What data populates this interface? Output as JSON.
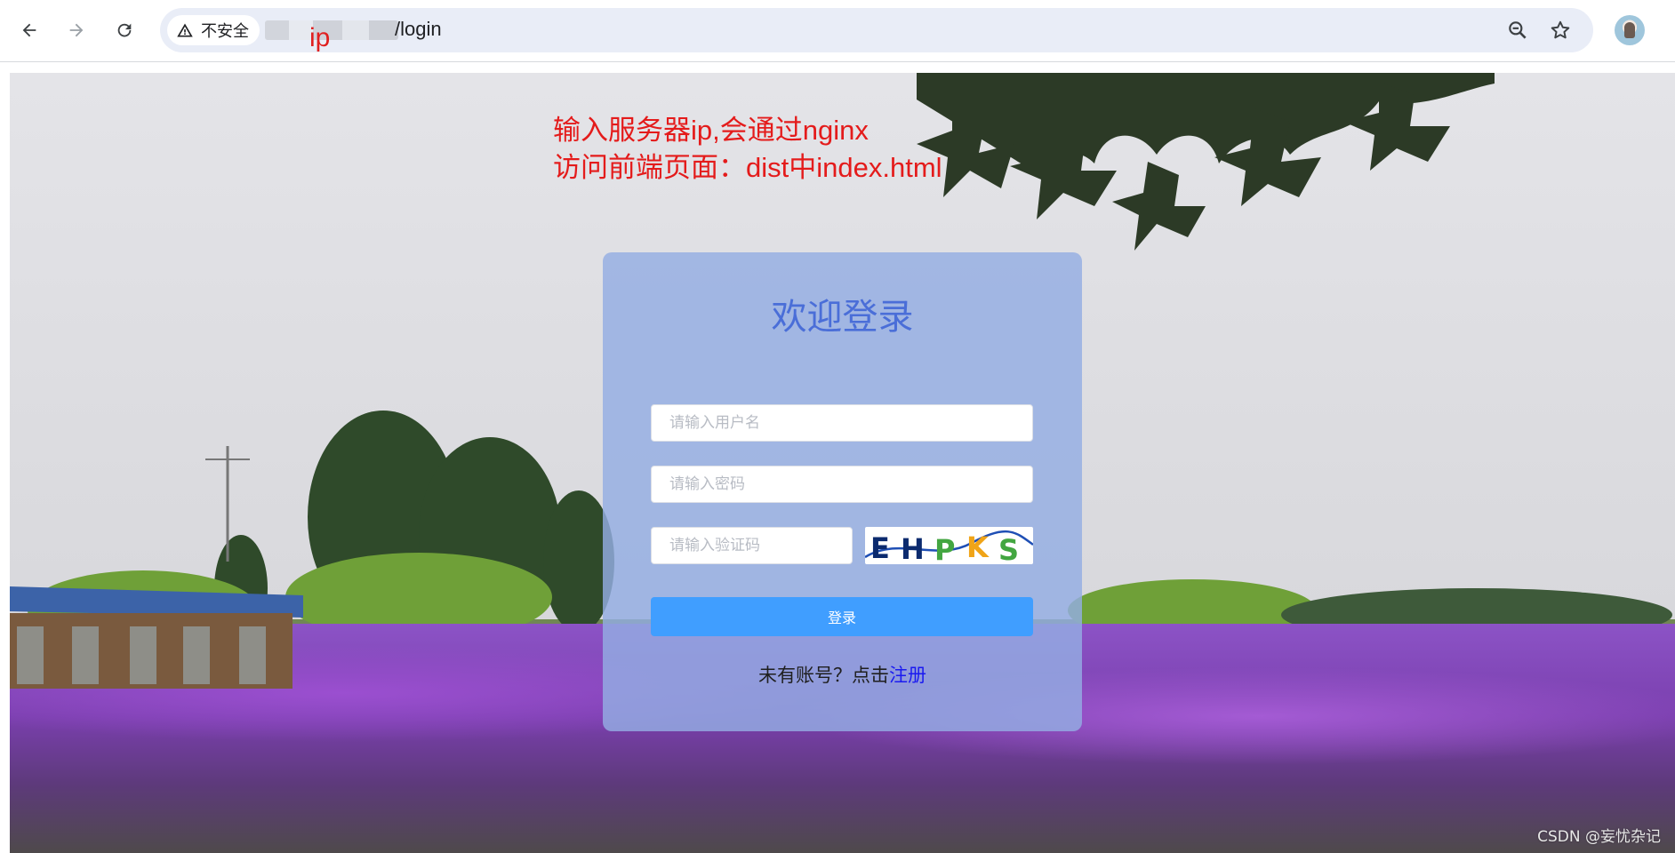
{
  "browser": {
    "security_label": "不安全",
    "url_suffix": "/login",
    "annotation_ip": "ip"
  },
  "annotation": {
    "line1": "输入服务器ip,会通过nginx",
    "line2": "访问前端页面：dist中index.html"
  },
  "login": {
    "title": "欢迎登录",
    "username_placeholder": "请输入用户名",
    "password_placeholder": "请输入密码",
    "captcha_placeholder": "请输入验证码",
    "captcha_text": "EHPKS",
    "login_button": "登录",
    "register_prompt": "未有账号？点击",
    "register_link": "注册"
  },
  "watermark": "CSDN @妄忧杂记",
  "colors": {
    "annotation": "#e41b1b",
    "title": "#4a6ed8",
    "button": "#409eff",
    "link": "#1a1af0"
  }
}
